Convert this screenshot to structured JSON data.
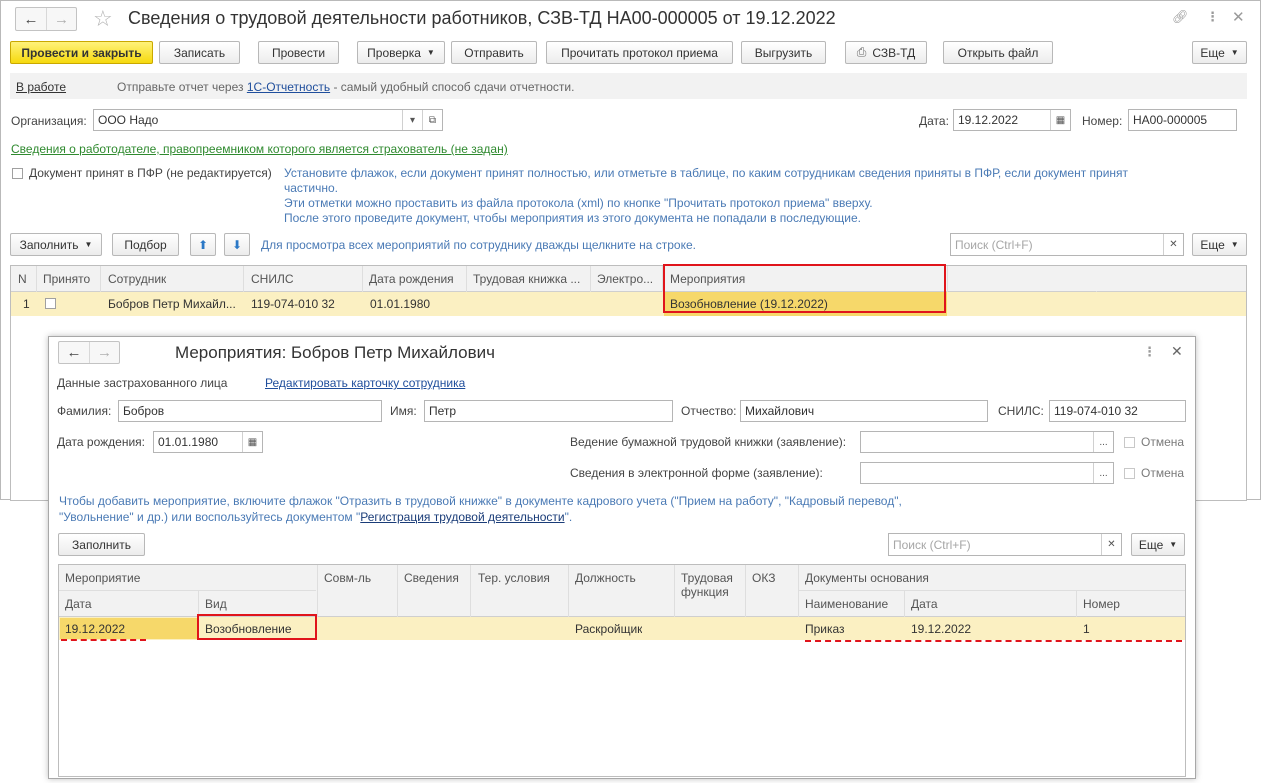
{
  "main": {
    "title": "Сведения о трудовой деятельности работников, СЗВ-ТД НА00-000005 от 19.12.2022",
    "toolbar": {
      "post_close": "Провести и закрыть",
      "save": "Записать",
      "post": "Провести",
      "check": "Проверка",
      "send": "Отправить",
      "read_protocol": "Прочитать протокол приема",
      "upload": "Выгрузить",
      "print": "СЗВ-ТД",
      "open_file": "Открыть файл",
      "more": "Еще"
    },
    "status_bar": {
      "status": "В работе",
      "msg_prefix": "Отправьте отчет через",
      "msg_link": "1С-Отчетность",
      "msg_suffix": "- самый удобный способ сдачи отчетности."
    },
    "org_label": "Организация:",
    "org_value": "ООО Надо",
    "date_label": "Дата:",
    "date_value": "19.12.2022",
    "number_label": "Номер:",
    "number_value": "НА00-000005",
    "successor_link": "Сведения о работодателе, правопреемником которого является страхователь (не задан)",
    "accepted_checkbox_label": "Документ принят в ПФР (не редактируется)",
    "hint_lines": [
      "Установите флажок, если документ принят полностью, или отметьте в таблице, по каким сотрудникам сведения приняты в ПФР, если документ принят",
      "частично.",
      "Эти отметки можно проставить из файла протокола (xml) по кнопке \"Прочитать протокол приема\" вверху.",
      "После этого проведите документ, чтобы мероприятия из этого документа не попадали в последующие."
    ],
    "table_toolbar": {
      "fill": "Заполнить",
      "select": "Подбор",
      "hint": "Для просмотра всех мероприятий по сотруднику дважды щелкните на строке.",
      "search_placeholder": "Поиск (Ctrl+F)",
      "more": "Еще"
    },
    "table": {
      "columns": [
        "N",
        "Принято",
        "Сотрудник",
        "СНИЛС",
        "Дата рождения",
        "Трудовая книжка ...",
        "Электро...",
        "Мероприятия"
      ],
      "rows": [
        {
          "n": "1",
          "employee": "Бобров Петр Михайл...",
          "snils": "119-074-010 32",
          "birth": "01.01.1980",
          "events": "Возобновление (19.12.2022)"
        }
      ]
    }
  },
  "sub": {
    "title": "Мероприятия: Бобров Петр Михайлович",
    "insured_label": "Данные застрахованного лица",
    "edit_card_link": "Редактировать карточку сотрудника",
    "surname_label": "Фамилия:",
    "surname_value": "Бобров",
    "name_label": "Имя:",
    "name_value": "Петр",
    "patronymic_label": "Отчество:",
    "patronymic_value": "Михайлович",
    "snils_label": "СНИЛС:",
    "snils_value": "119-074-010 32",
    "birth_label": "Дата рождения:",
    "birth_value": "01.01.1980",
    "paper_book_label": "Ведение бумажной трудовой книжки (заявление):",
    "electronic_label": "Сведения в электронной форме (заявление):",
    "cancel_label": "Отмена",
    "hint_line1": "Чтобы добавить мероприятие, включите флажок \"Отразить в трудовой книжке\" в документе кадрового учета (\"Прием на работу\", \"Кадровый перевод\",",
    "hint_line2_prefix": "\"Увольнение\" и др.) или воспользуйтесь документом \"",
    "hint_line2_link": "Регистрация трудовой деятельности",
    "hint_line2_suffix": "\".",
    "fill_btn": "Заполнить",
    "search_placeholder": "Поиск (Ctrl+F)",
    "more": "Еще",
    "table": {
      "group_event": "Мероприятие",
      "col_date": "Дата",
      "col_kind": "Вид",
      "col_combo": "Совм-ль",
      "col_info": "Сведения",
      "col_terr": "Тер. условия",
      "col_position": "Должность",
      "col_function": "Трудовая функция",
      "col_okz": "ОКЗ",
      "group_docs": "Документы основания",
      "col_doc_name": "Наименование",
      "col_doc_date": "Дата",
      "col_doc_num": "Номер",
      "row": {
        "date": "19.12.2022",
        "kind": "Возобновление",
        "position": "Раскройщик",
        "doc_name": "Приказ",
        "doc_date": "19.12.2022",
        "doc_num": "1"
      }
    }
  }
}
